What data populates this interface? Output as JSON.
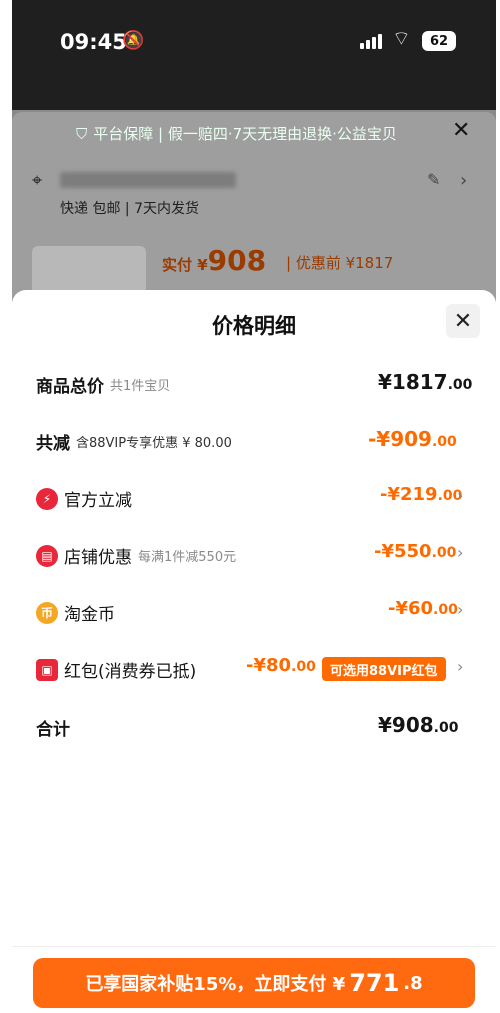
{
  "status": {
    "time": "09:45",
    "battery": "62"
  },
  "background": {
    "guarantee": "平台保障 | 假一赔四·7天无理由退换·公益宝贝",
    "shipping": "快递 包邮 | 7天内发货",
    "paid_label": "实付 ¥",
    "paid_amount": "908",
    "before_label": "| 优惠前 ¥1817"
  },
  "sheet": {
    "title": "价格明细",
    "rows": [
      {
        "label": "商品总价",
        "sub": "共1件宝贝",
        "value": "¥1817",
        "cents": ".00"
      },
      {
        "label": "共减",
        "note": "含88VIP专享优惠 ¥ 80.00",
        "value": "-¥909",
        "cents": ".00"
      },
      {
        "label": "官方立减",
        "value": "-¥219",
        "cents": ".00"
      },
      {
        "label": "店铺优惠",
        "sub": "每满1件减550元",
        "value": "-¥550",
        "cents": ".00"
      },
      {
        "label": "淘金币",
        "value": "-¥60",
        "cents": ".00"
      },
      {
        "label": "红包(消费券已抵)",
        "value": "-¥80",
        "cents": ".00",
        "badge": "可选用88VIP红包"
      },
      {
        "label": "合计",
        "value": "¥908",
        "cents": ".00"
      }
    ]
  },
  "pay_button": {
    "text": "已享国家补贴15%，立即支付 ¥",
    "amount": "771",
    "cents": ".8"
  },
  "colors": {
    "accent": "#ff6a00",
    "coupon_red": "#e8273a",
    "coin_gold": "#f5a623"
  }
}
